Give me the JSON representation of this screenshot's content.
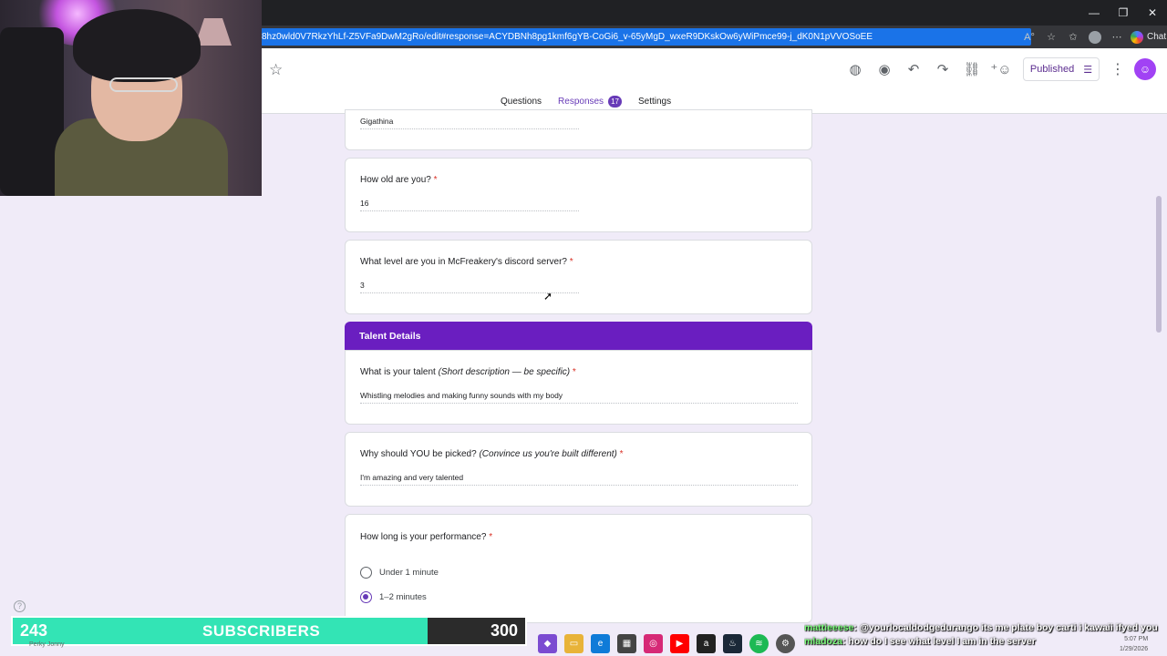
{
  "browser": {
    "url": "8hz0wld0V7RkzYhLf-Z5VFa9DwM2gRo/edit#response=ACYDBNh8pg1kmf6gYB-CoGi6_v-65yMgD_wxeR9DKskOw6yWiPmce99-j_dK0N1pVVOSoEE",
    "chat_label": "Chat",
    "window_controls": [
      "—",
      "❐",
      "✕"
    ]
  },
  "forms": {
    "published_label": "Published",
    "tabs": [
      {
        "label": "Questions"
      },
      {
        "label": "Responses",
        "count": "17"
      },
      {
        "label": "Settings"
      }
    ]
  },
  "responses": {
    "name_answer": "Gigathina",
    "q_age": {
      "title": "How old are you?",
      "answer": "16"
    },
    "q_level": {
      "title": "What level are you in McFreakery's discord server?",
      "answer": "3"
    },
    "section_title": "Talent Details",
    "q_talent": {
      "title_pre": "What is your talent ",
      "title_em": "(Short description — be specific)",
      "answer": "Whistling melodies and making funny sounds with my body"
    },
    "q_picked": {
      "title_pre": "Why should YOU be picked? ",
      "title_em": "(Convince us you're built different)",
      "answer": "I'm amazing and very talented"
    },
    "q_length": {
      "title": "How long is your performance?",
      "options": [
        {
          "label": "Under 1 minute",
          "selected": false
        },
        {
          "label": "1–2 minutes",
          "selected": true
        }
      ]
    },
    "required_marker": "*"
  },
  "stream": {
    "subscribers_count": "243",
    "subscribers_label": "SUBSCRIBERS",
    "subscribers_goal": "300",
    "goal_progress": 0.81,
    "ghost_name": "Perky Jonny",
    "chat": [
      {
        "user": "mattieeese",
        "message": ": @yourlocaldodgedurango its me plate boy carti i kawaii ifyed you"
      },
      {
        "user": "mladoza",
        "message": ": how do I see what level I am in the server"
      }
    ],
    "clock_time": "5:07 PM",
    "clock_date": "1/29/2026"
  },
  "colors": {
    "accent": "#673ab7",
    "section_header": "#6a1ec0",
    "background": "#f0ebf8",
    "sub_fill": "#33e4b5"
  }
}
